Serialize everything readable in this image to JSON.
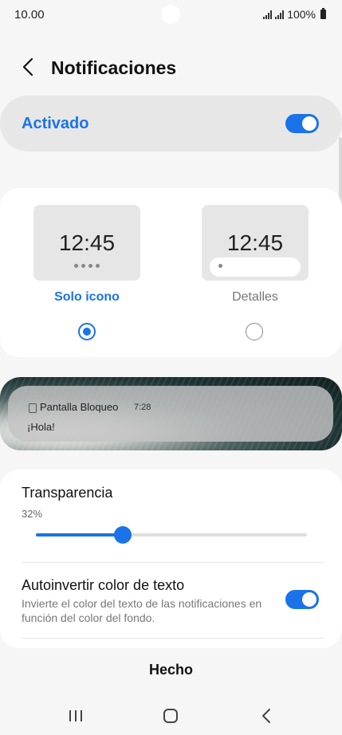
{
  "status_bar": {
    "time": "10.00",
    "battery": "100%"
  },
  "header": {
    "back_icon": "chevron-left-icon",
    "title": "Notificaciones"
  },
  "master_toggle": {
    "label": "Activado",
    "on": true
  },
  "styles": {
    "options": [
      {
        "time": "12:45",
        "label": "Solo icono",
        "selected": true
      },
      {
        "time": "12:45",
        "label": "Detalles",
        "selected": false
      }
    ]
  },
  "lock_preview": {
    "app": "Pantalla Bloqueo",
    "time": "7:28",
    "message": "¡Hola!"
  },
  "transparency": {
    "title": "Transparencia",
    "value": "32%",
    "level": 0.32
  },
  "autoinvert": {
    "title": "Autoinvertir color de texto",
    "description": "Invierte el color del texto de las notificaciones en función del color del fondo.",
    "on": true
  },
  "footer": {
    "done_label": "Hecho"
  },
  "nav": {
    "recent": "recent-apps-icon",
    "home": "home-icon",
    "back": "back-icon"
  },
  "colors": {
    "accent": "#1a73e8",
    "background": "#f6f6f6"
  }
}
